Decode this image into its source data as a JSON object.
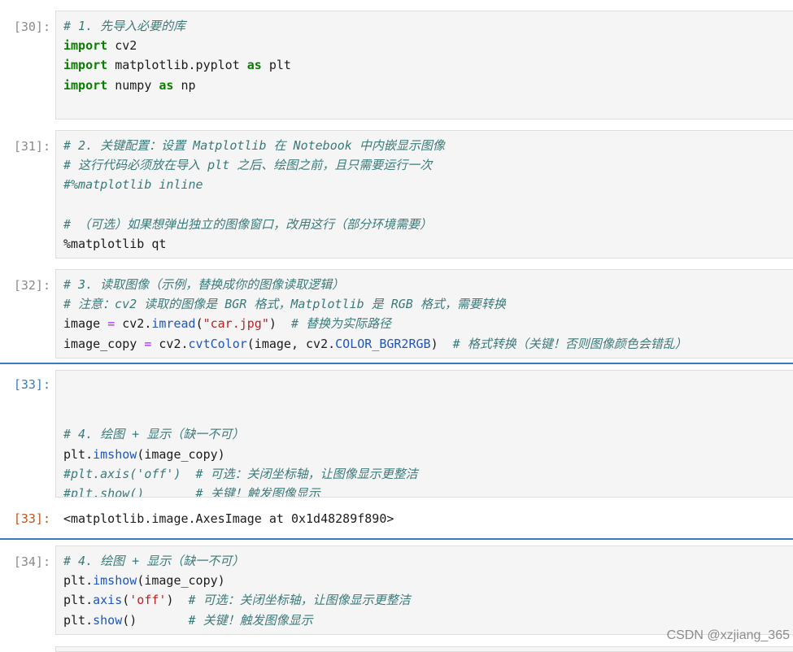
{
  "cells": [
    {
      "prompt": "[30]:",
      "lines": [
        [
          {
            "t": "# 1. 先导入必要的库",
            "c": "c"
          }
        ],
        [
          {
            "t": "import",
            "c": "k"
          },
          {
            "t": " cv2"
          }
        ],
        [
          {
            "t": "import",
            "c": "k"
          },
          {
            "t": " matplotlib.pyplot "
          },
          {
            "t": "as",
            "c": "k"
          },
          {
            "t": " plt"
          }
        ],
        [
          {
            "t": "import",
            "c": "k"
          },
          {
            "t": " numpy "
          },
          {
            "t": "as",
            "c": "k"
          },
          {
            "t": " np"
          }
        ]
      ]
    },
    {
      "prompt": "[31]:",
      "lines": [
        [
          {
            "t": "# 2. 关键配置：设置 Matplotlib 在 Notebook 中内嵌显示图像",
            "c": "c"
          }
        ],
        [
          {
            "t": "# 这行代码必须放在导入 plt 之后、绘图之前，且只需要运行一次",
            "c": "c"
          }
        ],
        [
          {
            "t": "#%matplotlib inline",
            "c": "c"
          }
        ],
        [
          {
            "t": ""
          }
        ],
        [
          {
            "t": "# （可选）如果想弹出独立的图像窗口，改用这行（部分环境需要）",
            "c": "c"
          }
        ],
        [
          {
            "t": "%matplotlib qt"
          }
        ]
      ]
    },
    {
      "prompt": "[32]:",
      "lines": [
        [
          {
            "t": "# 3. 读取图像（示例，替换成你的图像读取逻辑）",
            "c": "c"
          }
        ],
        [
          {
            "t": "# 注意：cv2 读取的图像是 BGR 格式，Matplotlib 是 RGB 格式，需要转换",
            "c": "c"
          }
        ],
        [
          {
            "t": "image "
          },
          {
            "t": "=",
            "c": "o"
          },
          {
            "t": " cv2."
          },
          {
            "t": "imread",
            "c": "f"
          },
          {
            "t": "("
          },
          {
            "t": "\"car.jpg\"",
            "c": "s"
          },
          {
            "t": ")  "
          },
          {
            "t": "# 替换为实际路径",
            "c": "c"
          }
        ],
        [
          {
            "t": "image_copy "
          },
          {
            "t": "=",
            "c": "o"
          },
          {
            "t": " cv2."
          },
          {
            "t": "cvtColor",
            "c": "f"
          },
          {
            "t": "(image, cv2."
          },
          {
            "t": "COLOR_BGR2RGB",
            "c": "f"
          },
          {
            "t": ")  "
          },
          {
            "t": "# 格式转换（关键！否则图像颜色会错乱）",
            "c": "c"
          }
        ]
      ]
    },
    {
      "prompt": "[33]:",
      "lines": [
        [
          {
            "t": ""
          }
        ],
        [
          {
            "t": ""
          }
        ],
        [
          {
            "t": "# 4. 绘图 + 显示（缺一不可）",
            "c": "c"
          }
        ],
        [
          {
            "t": "plt."
          },
          {
            "t": "imshow",
            "c": "f"
          },
          {
            "t": "(image_copy)"
          }
        ],
        [
          {
            "t": "#plt.axis('off')  # 可选：关闭坐标轴，让图像显示更整洁",
            "c": "c"
          }
        ],
        [
          {
            "t": "#plt.show()       # 关键！触发图像显示",
            "c": "c"
          }
        ]
      ],
      "output_prompt": "[33]:",
      "output": "<matplotlib.image.AxesImage at 0x1d48289f890>"
    },
    {
      "prompt": "[34]:",
      "lines": [
        [
          {
            "t": "# 4. 绘图 + 显示（缺一不可）",
            "c": "c"
          }
        ],
        [
          {
            "t": "plt."
          },
          {
            "t": "imshow",
            "c": "f"
          },
          {
            "t": "(image_copy)"
          }
        ],
        [
          {
            "t": "plt."
          },
          {
            "t": "axis",
            "c": "f"
          },
          {
            "t": "("
          },
          {
            "t": "'off'",
            "c": "s"
          },
          {
            "t": ")  "
          },
          {
            "t": "# 可选：关闭坐标轴，让图像显示更整洁",
            "c": "c"
          }
        ],
        [
          {
            "t": "plt."
          },
          {
            "t": "show",
            "c": "f"
          },
          {
            "t": "()       "
          },
          {
            "t": "# 关键！触发图像显示",
            "c": "c"
          }
        ]
      ]
    }
  ],
  "watermark": "CSDN @xzjiang_365"
}
